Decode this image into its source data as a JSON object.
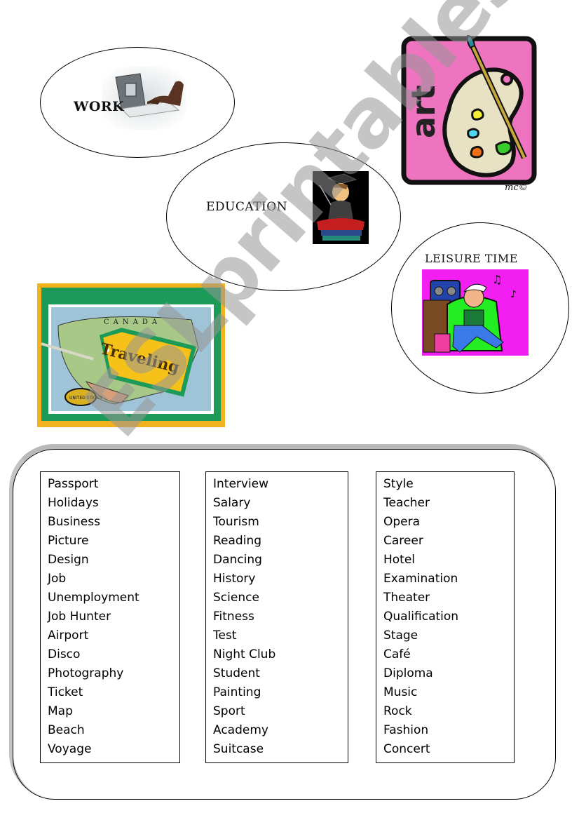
{
  "topics": {
    "work": "WORK",
    "education": "EDUCATION",
    "art": "art",
    "leisure": "LEISURE TIME",
    "traveling": "Traveling"
  },
  "images": {
    "art_signature": "mc©",
    "map_label": "CANADA",
    "map_seal": "UNITED STATES",
    "art_colors": {
      "card": "#ef74c0",
      "palette": "#e8e2c4",
      "yellow": "#f5f034",
      "cyan": "#4fd7ef",
      "orange": "#f07018",
      "green": "#38cc2c"
    },
    "leisure_bg": "#f21ef2",
    "travel_frame": "#f2b21e",
    "travel_green": "#1c9a58",
    "tag_color": "#f6c21a"
  },
  "watermark": "ESLprintables.com",
  "word_columns": [
    [
      "Passport",
      "Holidays",
      "Business",
      "Picture",
      "Design",
      "Job",
      "Unemployment",
      "Job Hunter",
      "Airport",
      "Disco",
      "Photography",
      "Ticket",
      "Map",
      "Beach",
      "Voyage"
    ],
    [
      "Interview",
      "Salary",
      "Tourism",
      "Reading",
      "Dancing",
      "History",
      "Science",
      "Fitness",
      "Test",
      "Night Club",
      "Student",
      "Painting",
      "Sport",
      "Academy",
      "Suitcase"
    ],
    [
      "Style",
      "Teacher",
      "Opera",
      "Career",
      "Hotel",
      "Examination",
      "Theater",
      "Qualification",
      "Stage",
      "Café",
      "Diploma",
      "Music",
      "Rock",
      "Fashion",
      "Concert"
    ]
  ]
}
